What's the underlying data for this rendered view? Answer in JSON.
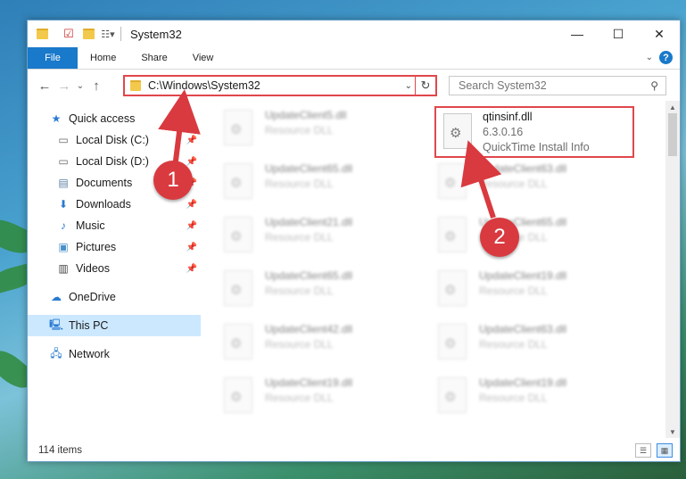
{
  "window": {
    "title": "System32",
    "controls": {
      "minimize": "—",
      "maximize": "☐",
      "close": "✕"
    }
  },
  "ribbon": {
    "tabs": [
      "File",
      "Home",
      "Share",
      "View"
    ],
    "help": "?"
  },
  "navigation": {
    "back": "←",
    "forward": "→",
    "recent": "⌄",
    "up": "↑",
    "address": "C:\\Windows\\System32",
    "refresh": "↻",
    "search_placeholder": "Search System32"
  },
  "sidebar": {
    "items": [
      {
        "label": "Quick access",
        "icon": "star-icon"
      },
      {
        "label": "Local Disk (C:)",
        "icon": "drive-icon",
        "pinned": true
      },
      {
        "label": "Local Disk (D:)",
        "icon": "drive-icon",
        "pinned": true
      },
      {
        "label": "Documents",
        "icon": "documents-icon",
        "pinned": true
      },
      {
        "label": "Downloads",
        "icon": "download-icon",
        "pinned": true
      },
      {
        "label": "Music",
        "icon": "music-icon",
        "pinned": true
      },
      {
        "label": "Pictures",
        "icon": "pictures-icon",
        "pinned": true
      },
      {
        "label": "Videos",
        "icon": "videos-icon",
        "pinned": true
      },
      {
        "label": "OneDrive",
        "icon": "cloud-icon"
      },
      {
        "label": "This PC",
        "icon": "computer-icon",
        "selected": true
      },
      {
        "label": "Network",
        "icon": "network-icon"
      }
    ]
  },
  "files": {
    "highlighted": {
      "name": "qtinsinf.dll",
      "version": "6.3.0.16",
      "description": "QuickTime Install Info"
    },
    "blurred": [
      {
        "name": "UpdateClient5.dll",
        "type": "Resource DLL"
      },
      {
        "name": "UpdateClient65.dll",
        "type": "Resource DLL"
      },
      {
        "name": "UpdateClient63.dll",
        "type": "Resource DLL"
      },
      {
        "name": "UpdateClient21.dll",
        "type": "Resource DLL"
      },
      {
        "name": "UpdateClient65.dll",
        "type": "Resource DLL"
      },
      {
        "name": "UpdateClient65.dll",
        "type": "Resource DLL"
      },
      {
        "name": "UpdateClient19.dll",
        "type": "Resource DLL"
      },
      {
        "name": "UpdateClient42.dll",
        "type": "Resource DLL"
      },
      {
        "name": "UpdateClient63.dll",
        "type": "Resource DLL"
      },
      {
        "name": "UpdateClient19.dll",
        "type": "Resource DLL"
      },
      {
        "name": "UpdateClient19.dll",
        "type": "Resource DLL"
      }
    ]
  },
  "status": {
    "item_count": "114 items"
  },
  "annotations": {
    "marker1": "1",
    "marker2": "2",
    "color": "#d93a3f"
  },
  "colors": {
    "accent": "#1979ca",
    "highlight_border": "#e0474c",
    "selected_bg": "#cce8ff"
  }
}
